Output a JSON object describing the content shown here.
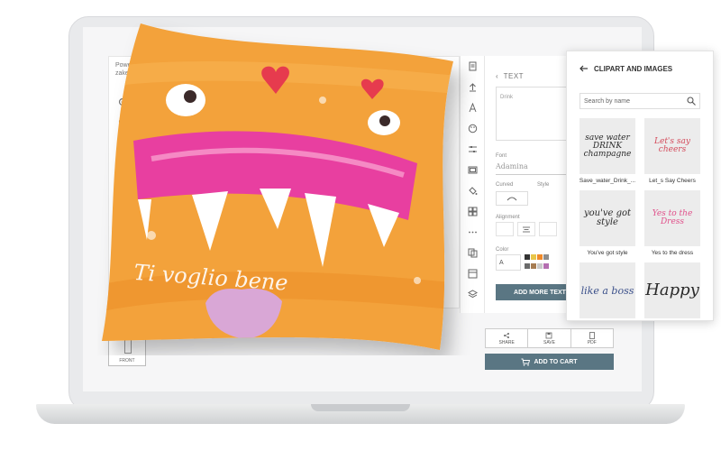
{
  "powered": {
    "line1": "Powered by",
    "line2": "zakeke.com"
  },
  "tools": [
    {
      "name": "zoom-in-icon",
      "label": ""
    },
    {
      "name": "zoom-out-icon",
      "label": ""
    },
    {
      "name": "undo-icon",
      "label": "undo"
    },
    {
      "name": "redo-icon",
      "label": "redo"
    },
    {
      "name": "reset-icon",
      "label": "reset"
    }
  ],
  "view_3d": "3D",
  "view_front": "FRONT",
  "text_panel": {
    "title": "TEXT",
    "text_value": "Drink",
    "font_label": "Font",
    "font_value": "Adamina",
    "curved_label": "Curved",
    "style_label": "Style",
    "alignment_label": "Alignment",
    "color_label": "Color",
    "color_value": "A",
    "swatches": [
      "#333333",
      "#e8c64a",
      "#f08a2a",
      "#8d8d8d",
      "#6b6b6b",
      "#a67c52",
      "#c9c9c9",
      "#b56fb1"
    ],
    "add_more": "ADD MORE TEXT"
  },
  "actions": {
    "share": "SHARE",
    "save": "SAVE",
    "pdf": "PDF",
    "add_to_cart": "ADD TO CART"
  },
  "clipart": {
    "title": "CLIPART AND IMAGES",
    "search_placeholder": "Search by name",
    "items": [
      {
        "caption": "Save_water_Drink_...",
        "art": "save water DRINK champagne"
      },
      {
        "caption": "Let_s Say Cheers",
        "art": "Let's say cheers"
      },
      {
        "caption": "You've got style",
        "art": "you've got style"
      },
      {
        "caption": "Yes to the dress",
        "art": "Yes to the Dress"
      },
      {
        "caption": "",
        "art": "like a boss"
      },
      {
        "caption": "",
        "art": "Happy"
      }
    ]
  },
  "pillow_text": "Ti voglio bene",
  "colors": {
    "accent": "#5a7683",
    "pillow_orange": "#f3a23a",
    "pillow_pink": "#e83fa0"
  }
}
